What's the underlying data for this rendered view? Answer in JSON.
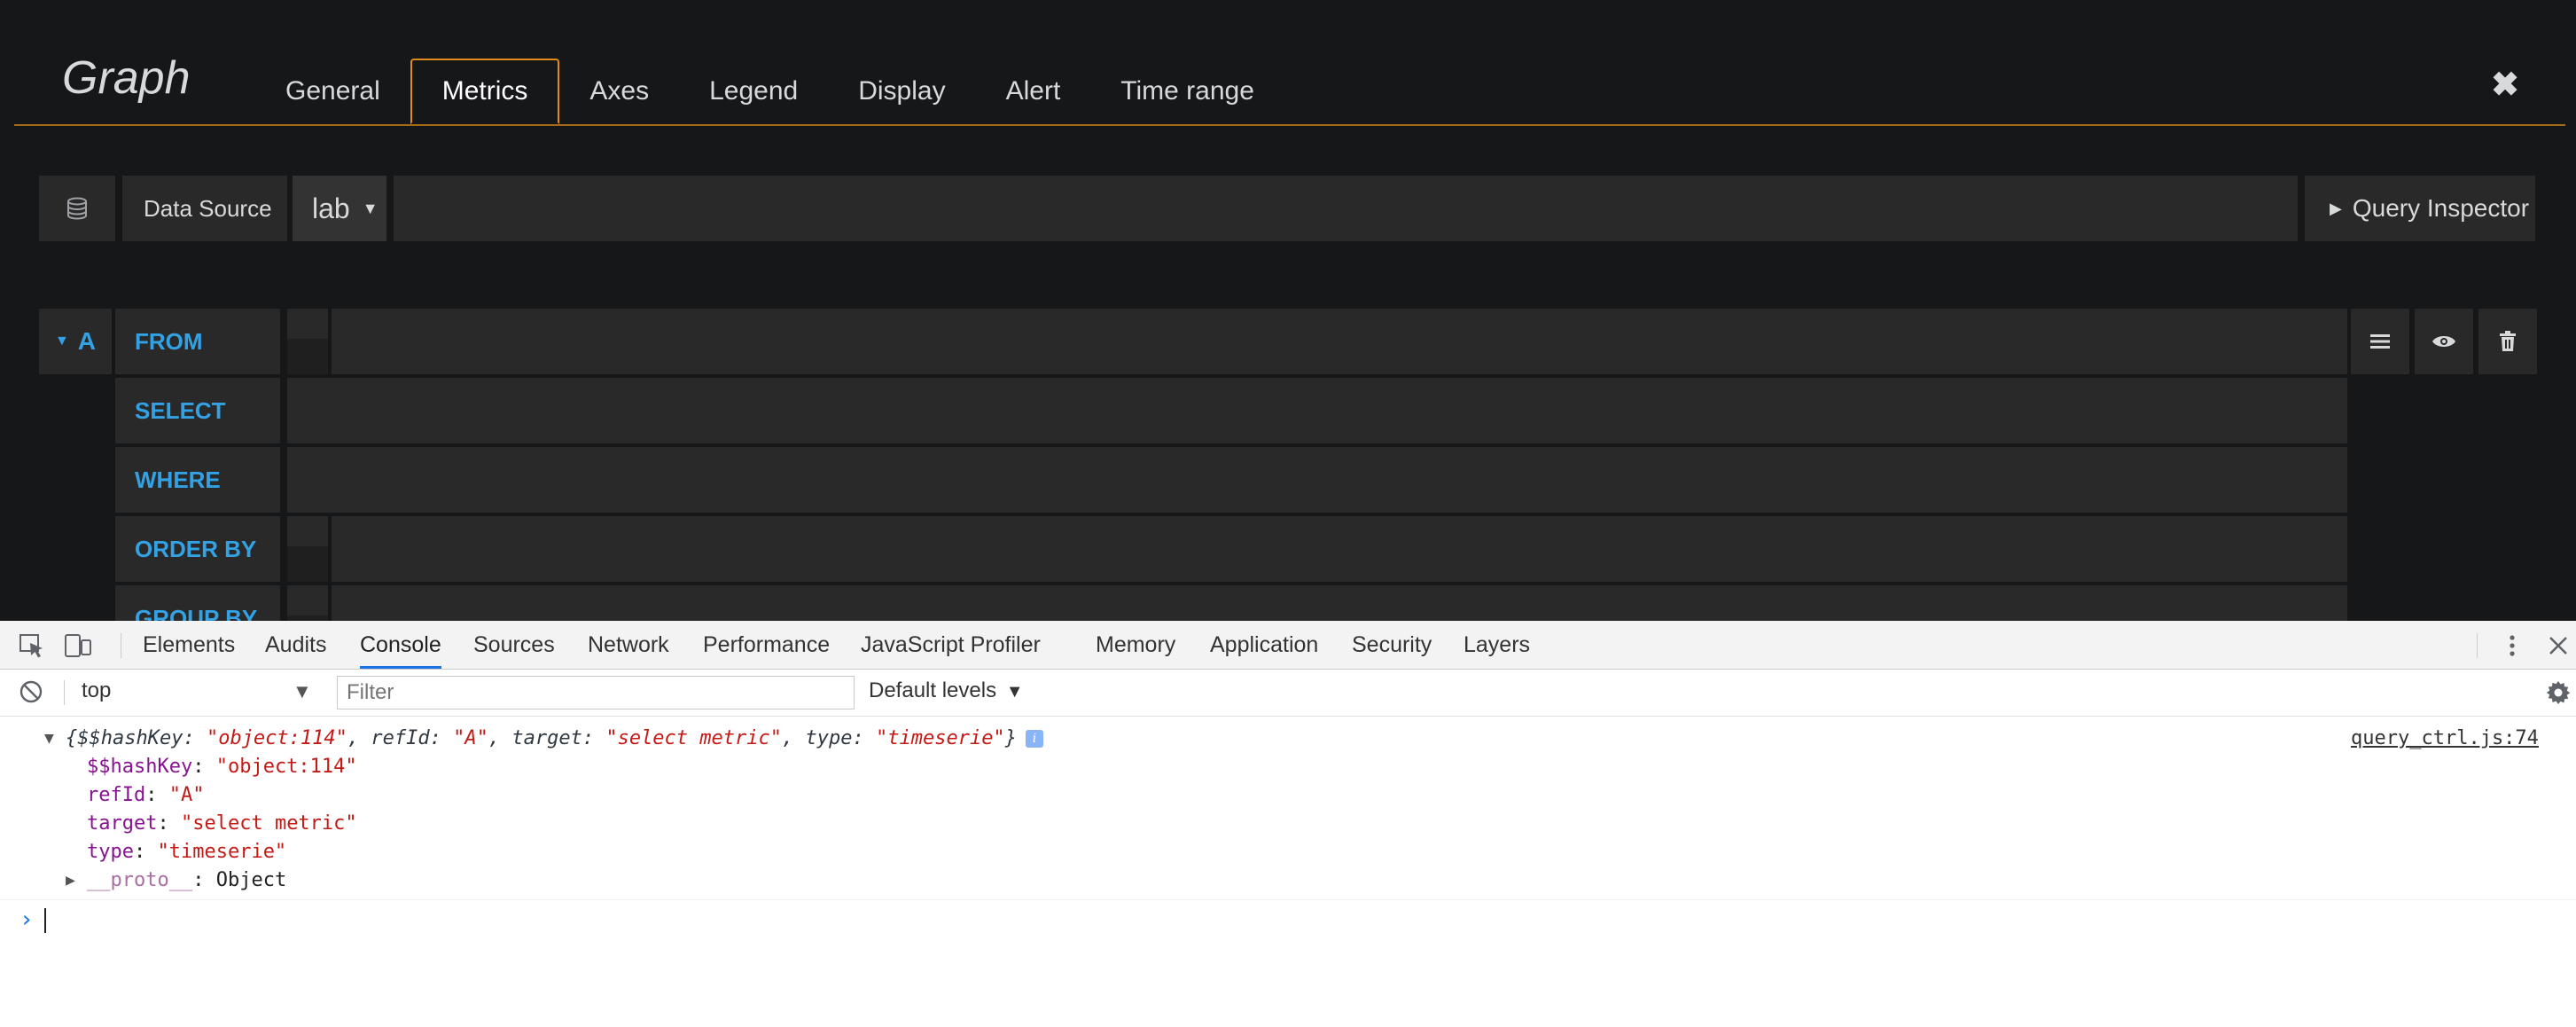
{
  "panel": {
    "title": "Graph",
    "tabs": [
      "General",
      "Metrics",
      "Axes",
      "Legend",
      "Display",
      "Alert",
      "Time range"
    ],
    "active_tab": "Metrics",
    "close_symbol": "✖"
  },
  "datasource": {
    "label": "Data Source",
    "selected": "lab",
    "query_inspector": "Query Inspector"
  },
  "query": {
    "ref": "A",
    "rows": [
      "FROM",
      "SELECT",
      "WHERE",
      "ORDER BY",
      "GROUP BY"
    ]
  },
  "devtools": {
    "tabs": [
      "Elements",
      "Audits",
      "Console",
      "Sources",
      "Network",
      "Performance",
      "JavaScript Profiler",
      "Memory",
      "Application",
      "Security",
      "Layers"
    ],
    "active_tab": "Console",
    "context": "top",
    "filter_placeholder": "Filter",
    "levels": "Default levels"
  },
  "console": {
    "summary_prefix": "{$$hashKey: ",
    "hashkey_val": "\"object:114\"",
    "ref_label": ", refId: ",
    "ref_val": "\"A\"",
    "target_label": ", target: ",
    "target_val": "\"select metric\"",
    "type_label": ", type: ",
    "type_val": "\"timeserie\"",
    "summary_suffix": "}",
    "source": "query_ctrl.js:74",
    "props": [
      {
        "key": "$$hashKey",
        "value": "\"object:114\""
      },
      {
        "key": "refId",
        "value": "\"A\""
      },
      {
        "key": "target",
        "value": "\"select metric\""
      },
      {
        "key": "type",
        "value": "\"timeserie\""
      }
    ],
    "proto_key": "__proto__",
    "proto_value": "Object"
  }
}
